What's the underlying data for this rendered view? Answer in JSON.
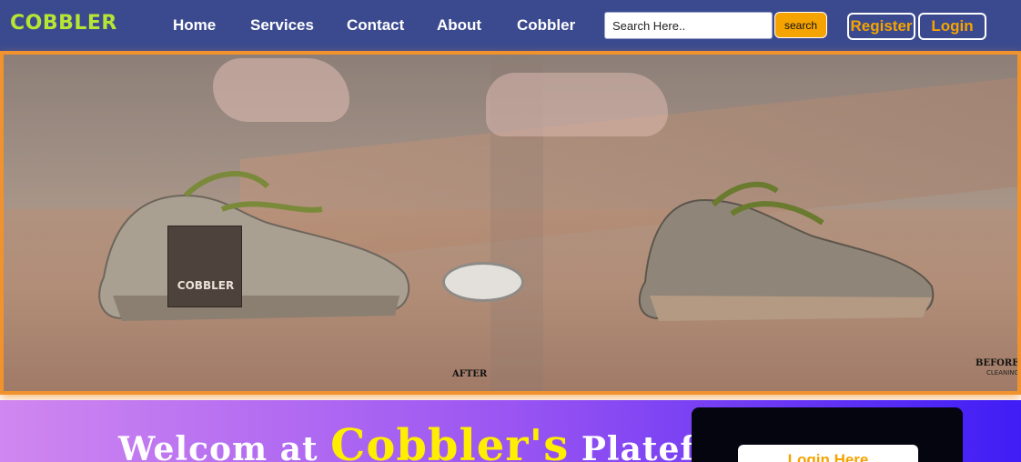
{
  "navbar": {
    "brand": "COBBLER",
    "links": [
      "Home",
      "Services",
      "Contact",
      "About",
      "Cobbler"
    ],
    "search": {
      "placeholder": "Search Here..",
      "value": "",
      "button_label": "search"
    },
    "register_label": "Register",
    "login_label": "Login"
  },
  "hero": {
    "tag_text": "COBBLER",
    "after_label": "AFTER",
    "before_label": "BEFORE",
    "cleaning_label": "CLEANING"
  },
  "welcome": {
    "prefix": "Welcom at",
    "brand": "Cobbler's",
    "suffix": "Plateform",
    "login_panel_button": "Login Here"
  },
  "colors": {
    "navbar_bg": "#3b4a8f",
    "brand": "#b6e534",
    "accent_orange": "#f5a300",
    "welcome_gradient_start": "#d087f0",
    "welcome_gradient_end": "#3f1df5",
    "brand_yellow": "#ffee00"
  }
}
